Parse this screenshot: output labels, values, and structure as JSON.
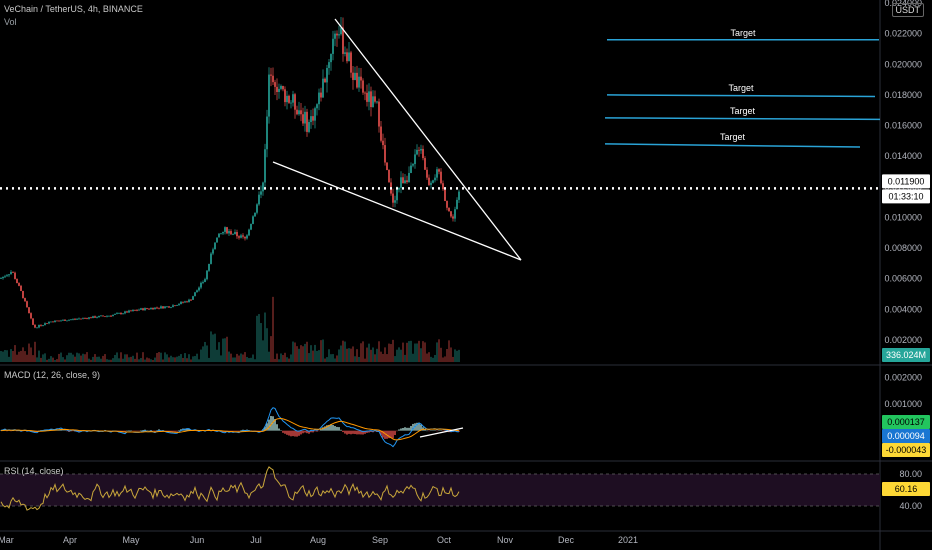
{
  "header": {
    "symbol_line": "VeChain / TetherUS, 4h, BINANCE",
    "volume_label": "Vol",
    "currency": "USDT"
  },
  "price_axis": {
    "ticks": [
      "0.024000",
      "0.022000",
      "0.020000",
      "0.018000",
      "0.016000",
      "0.014000",
      "0.012000",
      "0.010000",
      "0.008000",
      "0.006000",
      "0.004000",
      "0.002000"
    ],
    "last_price": "0.011900",
    "countdown": "01:33:10",
    "volume_readout": "336.024M"
  },
  "macd": {
    "label": "MACD (12, 26, close, 9)",
    "ticks": [
      "0.002000",
      "0.001000"
    ],
    "macd_value": "0.000137",
    "signal_value": "0.000094",
    "histogram_value": "-0.000043"
  },
  "rsi": {
    "label": "RSI (14, close)",
    "ticks": [
      "80.00",
      "40.00"
    ],
    "value": "60.16"
  },
  "time_axis": [
    "Mar",
    "Apr",
    "May",
    "Jun",
    "Jul",
    "Aug",
    "Sep",
    "Oct",
    "Nov",
    "Dec",
    "2021"
  ],
  "annotations": {
    "targets": [
      "Target",
      "Target",
      "Target",
      "Target"
    ]
  },
  "colors": {
    "background": "#000000",
    "up_candle": "#26a69a",
    "down_candle": "#ef5350",
    "wedge_lines": "#ffffff",
    "target_lines": "#2aa3d6",
    "macd_line": "#2196f3",
    "signal_line": "#ff9800",
    "rsi_line": "#c8a63b",
    "rsi_band": "#1e0e22",
    "macd_badge": "#22c55e",
    "signal_badge": "#1976d2",
    "hist_badge": "#fdd835",
    "volume_badge": "#26a69a"
  },
  "chart_data": {
    "type": "line",
    "title": "VeChain / TetherUS, 4h, BINANCE",
    "x": [
      "Mar",
      "Apr",
      "May",
      "Jun",
      "Jul",
      "Aug",
      "Sep",
      "Oct"
    ],
    "series": [
      {
        "values": [
          0.0062,
          0.0028,
          0.0034,
          0.0042,
          0.0195,
          0.0215,
          0.0112,
          0.0119
        ]
      }
    ],
    "ylim": [
      0,
      0.024
    ],
    "target_levels": [
      0.0216,
      0.018,
      0.0165,
      0.0148
    ],
    "last_price": 0.0119,
    "rsi_last": 60.16,
    "macd_last": 0.000137,
    "signal_last": 9.4e-05,
    "hist_last": -4.3e-05
  }
}
